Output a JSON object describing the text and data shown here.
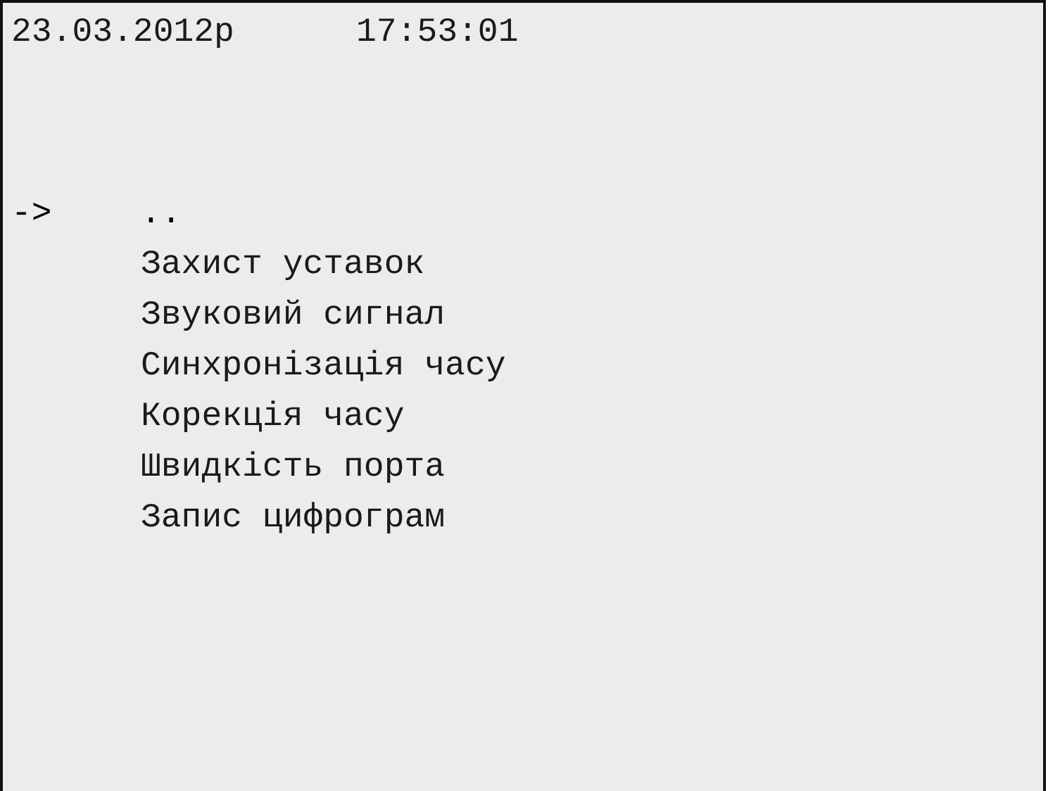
{
  "header": {
    "date": "23.03.2012р",
    "time": "17:53:01"
  },
  "menu": {
    "cursor": "->",
    "items": [
      {
        "label": "..",
        "selected": true
      },
      {
        "label": "Захист уставок",
        "selected": false
      },
      {
        "label": "Звуковий сигнал",
        "selected": false
      },
      {
        "label": "Синхронізація часу",
        "selected": false
      },
      {
        "label": "Корекція часу",
        "selected": false
      },
      {
        "label": "Швидкість порта",
        "selected": false
      },
      {
        "label": "Запис цифрограм",
        "selected": false
      }
    ]
  }
}
